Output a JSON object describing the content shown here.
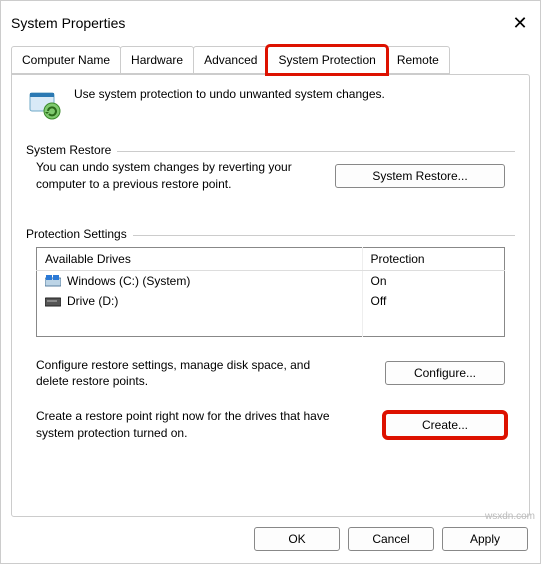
{
  "window": {
    "title": "System Properties",
    "close_glyph": "✕"
  },
  "tabs": {
    "computer_name": "Computer Name",
    "hardware": "Hardware",
    "advanced": "Advanced",
    "system_protection": "System Protection",
    "remote": "Remote"
  },
  "intro": {
    "text": "Use system protection to undo unwanted system changes.",
    "icon": "system-protection-icon"
  },
  "system_restore": {
    "group_label": "System Restore",
    "desc": "You can undo system changes by reverting your computer to a previous restore point.",
    "button": "System Restore..."
  },
  "protection_settings": {
    "group_label": "Protection Settings",
    "columns": {
      "drives": "Available Drives",
      "protection": "Protection"
    },
    "rows": [
      {
        "icon": "windows-drive-icon",
        "name": "Windows (C:) (System)",
        "protection": "On"
      },
      {
        "icon": "drive-icon",
        "name": "Drive (D:)",
        "protection": "Off"
      }
    ],
    "configure": {
      "desc": "Configure restore settings, manage disk space, and delete restore points.",
      "button": "Configure..."
    },
    "create": {
      "desc": "Create a restore point right now for the drives that have system protection turned on.",
      "button": "Create..."
    }
  },
  "footer": {
    "ok": "OK",
    "cancel": "Cancel",
    "apply": "Apply"
  },
  "watermark": "wsxdn.com"
}
